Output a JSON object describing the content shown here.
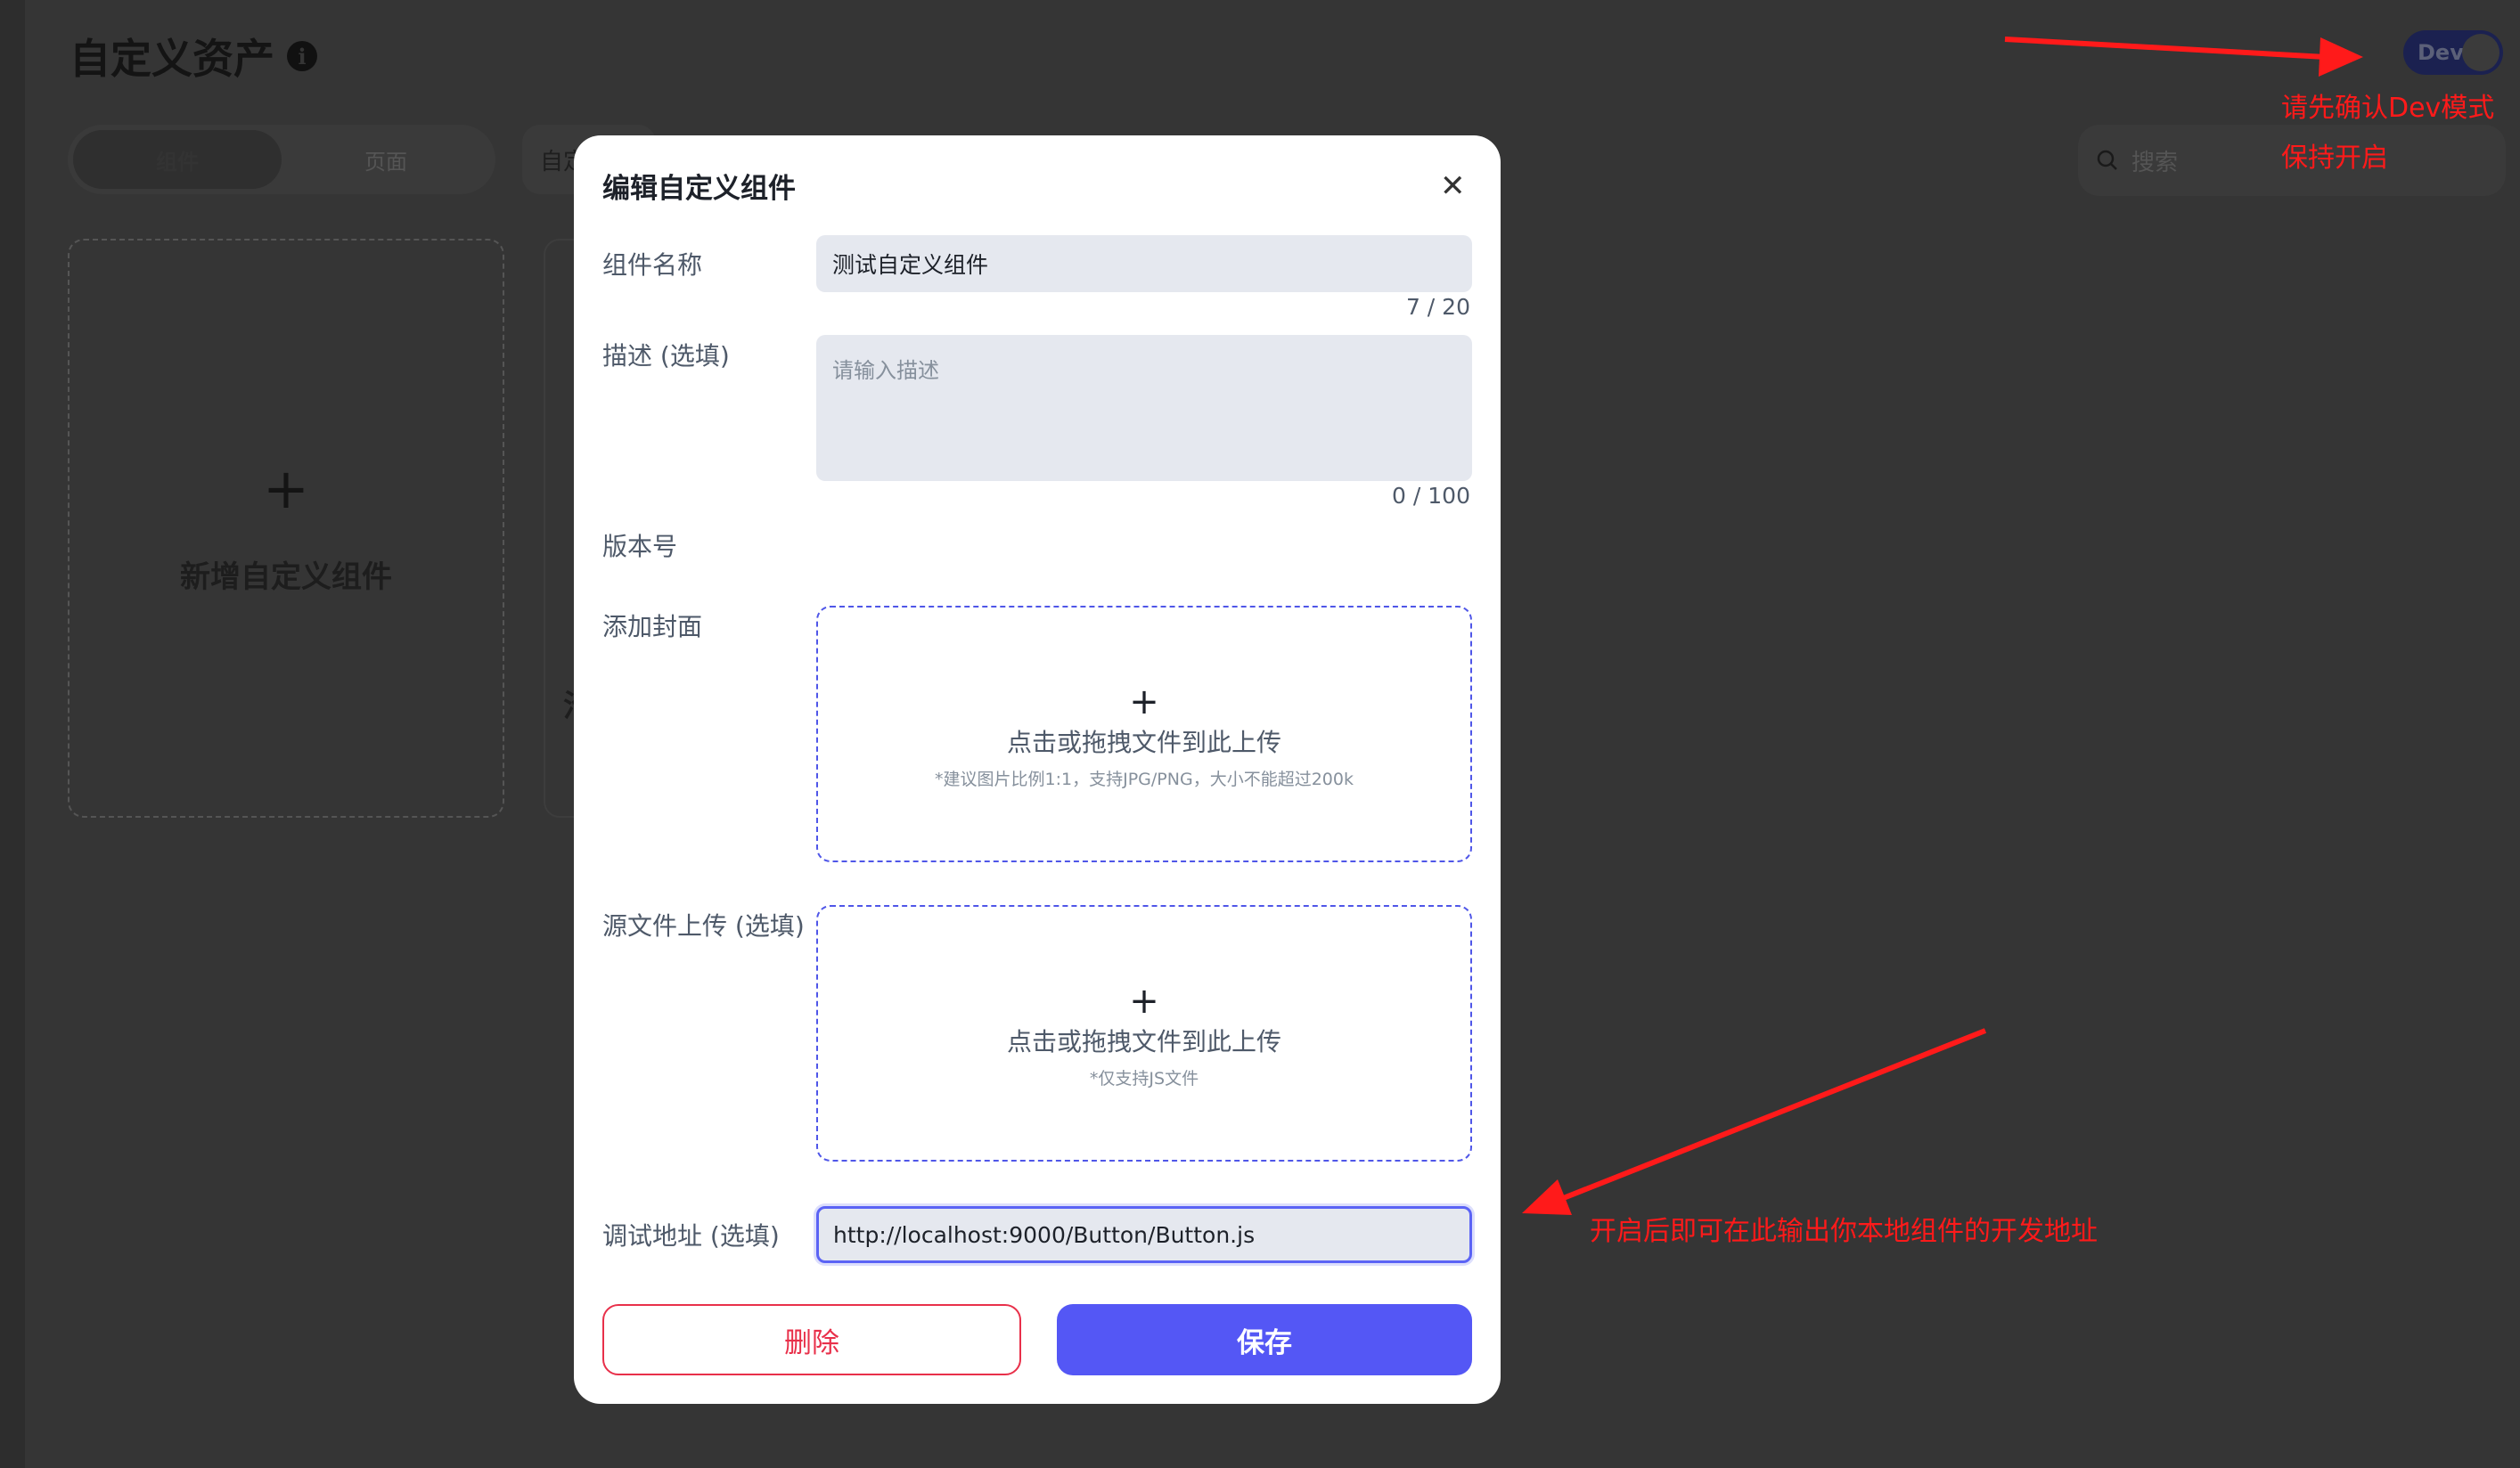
{
  "page": {
    "title": "自定义资产",
    "tabs": [
      "组件",
      "页面"
    ],
    "second_tab_label": "自定",
    "search_placeholder": "搜索",
    "add_card_label": "新增自定义组件",
    "card2_partial": "治",
    "dev_label": "Dev"
  },
  "annotations": {
    "top_right_line1": "请先确认Dev模式",
    "top_right_line2": "保持开启",
    "debug_note": "开启后即可在此输出你本地组件的开发地址",
    "color": "#ff1a1a"
  },
  "modal": {
    "title": "编辑自定义组件",
    "close_icon": "close-icon",
    "fields": {
      "name_label": "组件名称",
      "name_value": "测试自定义组件",
      "name_counter": "7 / 20",
      "desc_label": "描述 (选填)",
      "desc_placeholder": "请输入描述",
      "desc_counter": "0 / 100",
      "version_label": "版本号",
      "cover_label": "添加封面",
      "cover_upload_text": "点击或拖拽文件到此上传",
      "cover_upload_hint": "*建议图片比例1:1，支持JPG/PNG，大小不能超过200k",
      "source_label": "源文件上传 (选填)",
      "source_upload_text": "点击或拖拽文件到此上传",
      "source_upload_hint": "*仅支持JS文件",
      "debug_label": "调试地址 (选填)",
      "debug_value": "http://localhost:9000/Button/Button.js"
    },
    "delete_label": "删除",
    "save_label": "保存",
    "colors": {
      "primary": "#5457f5",
      "danger": "#e8304a"
    }
  }
}
